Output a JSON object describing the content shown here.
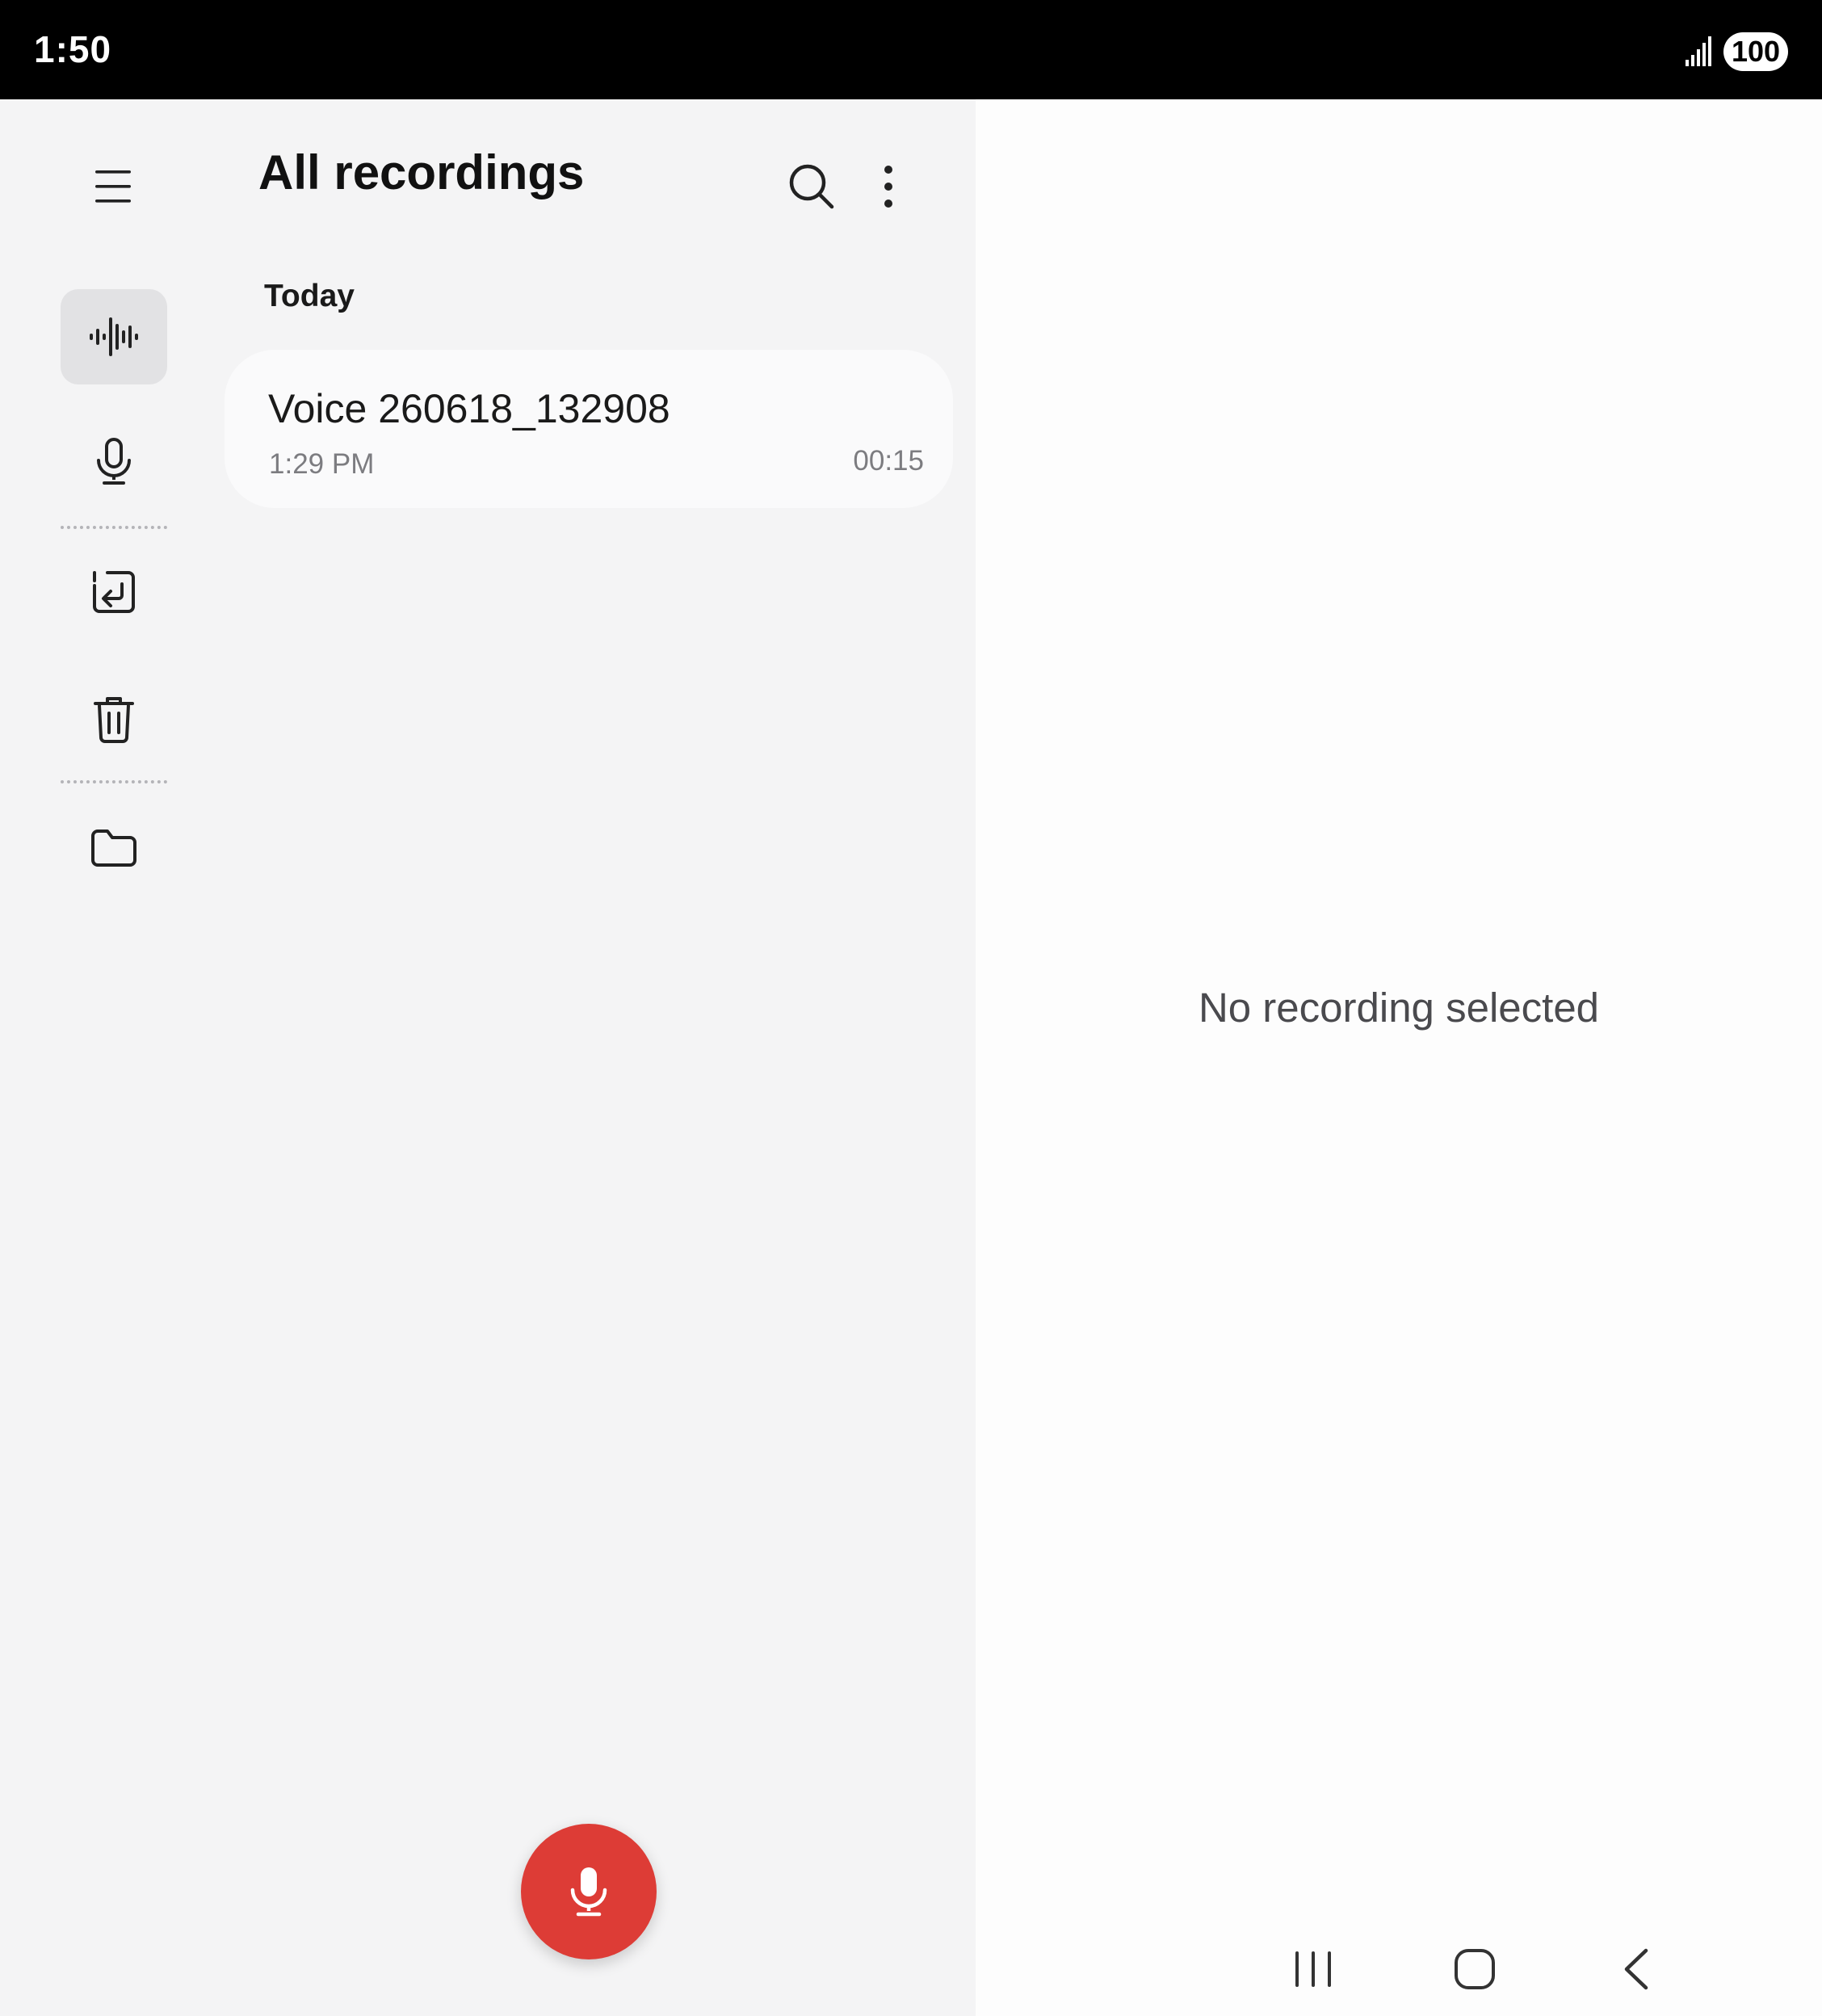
{
  "status_bar": {
    "time": "1:50",
    "battery": "100",
    "signal_icon": "cellular-signal-icon"
  },
  "nav_rail": {
    "menu_icon": "hamburger-menu-icon",
    "items": [
      {
        "name": "all-recordings",
        "icon": "waveform-icon",
        "active": true
      },
      {
        "name": "record",
        "icon": "microphone-icon",
        "active": false
      },
      {
        "name": "import",
        "icon": "import-icon",
        "active": false
      },
      {
        "name": "trash",
        "icon": "trash-icon",
        "active": false
      },
      {
        "name": "folders",
        "icon": "folder-icon",
        "active": false
      }
    ]
  },
  "header": {
    "title": "All recordings",
    "search_icon": "search-icon",
    "more_icon": "more-vert-icon"
  },
  "list": {
    "section": "Today",
    "recordings": [
      {
        "title": "Voice 260618_132908",
        "time": "1:29 PM",
        "duration": "00:15"
      }
    ]
  },
  "fab": {
    "icon": "microphone-icon"
  },
  "detail": {
    "empty_text": "No recording selected"
  },
  "system_nav": {
    "recents_icon": "recents-icon",
    "home_icon": "home-icon",
    "back_icon": "back-icon"
  },
  "colors": {
    "accent": "#dd3c36",
    "list_bg": "#f4f4f5",
    "detail_bg": "#fdfdfd",
    "card_bg": "#fafafb",
    "active_rail_bg": "#e2e2e4"
  }
}
